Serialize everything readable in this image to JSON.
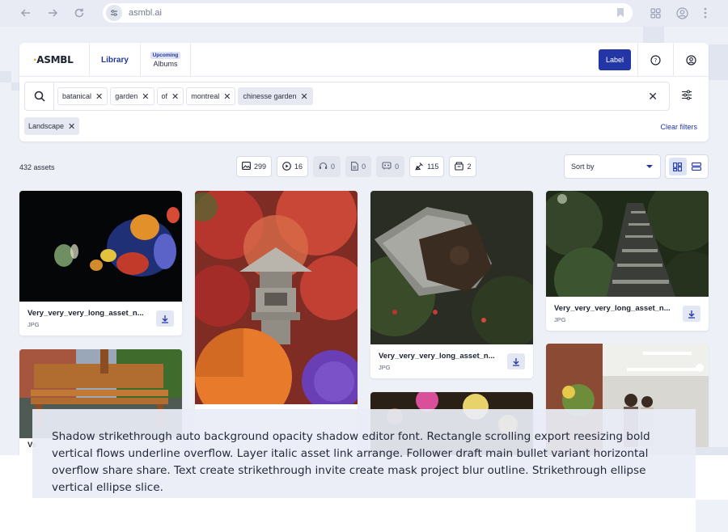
{
  "browser": {
    "url": "asmbl.ai"
  },
  "app": {
    "logo": "ASMBL",
    "tabs": {
      "library": "Library",
      "albums": "Albums",
      "albums_badge": "Upcoming"
    },
    "label_button": "Label"
  },
  "search": {
    "chips": [
      {
        "text": "batanical",
        "highlighted": false
      },
      {
        "text": "garden",
        "highlighted": false
      },
      {
        "text": "of",
        "highlighted": false
      },
      {
        "text": "montreal",
        "highlighted": false
      },
      {
        "text": "chinesse garden",
        "highlighted": true
      }
    ],
    "filter_chip": "Landscape",
    "clear_filters": "Clear filters"
  },
  "toolbar": {
    "asset_count": "432 assets",
    "counters": [
      {
        "icon": "image-icon",
        "value": "299",
        "enabled": true
      },
      {
        "icon": "video-icon",
        "value": "16",
        "enabled": true
      },
      {
        "icon": "audio-icon",
        "value": "0",
        "enabled": false
      },
      {
        "icon": "document-icon",
        "value": "0",
        "enabled": false
      },
      {
        "icon": "3d-icon",
        "value": "0",
        "enabled": false
      },
      {
        "icon": "vector-icon",
        "value": "115",
        "enabled": true
      },
      {
        "icon": "archive-icon",
        "value": "2",
        "enabled": true
      }
    ],
    "sort_by": "Sort by"
  },
  "assets": [
    {
      "name": "Very_very_very_long_asset_n...",
      "type": "JPG",
      "image": "night-lantern-dragon"
    },
    {
      "name": "",
      "type": "",
      "image": "red-maple-lantern-umbrellas"
    },
    {
      "name": "Very_very_very_long_asset_n...",
      "type": "JPG",
      "image": "trowel-soil"
    },
    {
      "name": "Very_very_very_long_asset_n...",
      "type": "JPG",
      "image": "forest-stone-steps"
    },
    {
      "name": "Ve",
      "type": "",
      "image": "wooden-bench"
    },
    {
      "name": "",
      "type": "",
      "image": "night-lanterns"
    },
    {
      "name": "",
      "type": "",
      "image": "brick-office"
    }
  ],
  "caption": "Shadow strikethrough auto background opacity shadow editor font. Rectangle scrolling export reesizing bold vertical flows underline overflow. Layer italic asset link arrange. Follower draft main bullet variant horizontal overflow share share. Text create strikethrough invite create mask project blur outline. Strikethrough ellipse vertical ellipse slice.",
  "colors": {
    "brand": "#2336a5",
    "accent": "#e4a21f",
    "page_bg": "#edf0f6"
  }
}
